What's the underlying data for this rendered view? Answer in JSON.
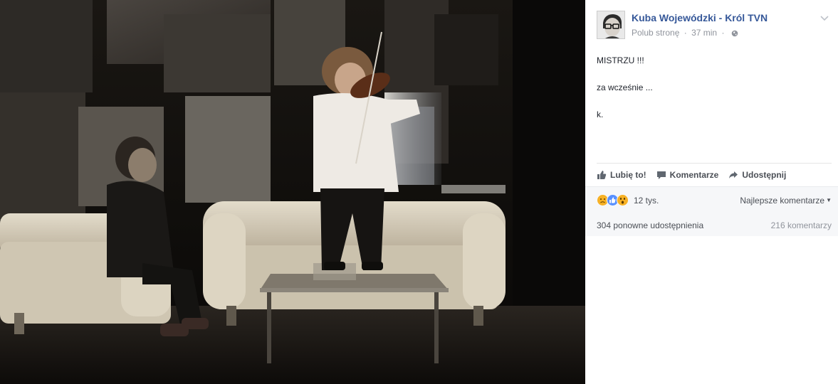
{
  "post": {
    "page_name": "Kuba Wojewódzki - Król TVN",
    "like_page_label": "Polub stronę",
    "separator": "·",
    "timestamp": "37 min",
    "audience_icon": "globe-icon",
    "text_lines": [
      "MISTRZU !!!",
      "za wcześnie ...",
      "k."
    ]
  },
  "actions": {
    "like_label": "Lubię to!",
    "comment_label": "Komentarze",
    "share_label": "Udostępnij"
  },
  "reactions": {
    "icons": [
      "sad-reaction-icon",
      "like-reaction-icon",
      "wow-reaction-icon"
    ],
    "count": "12 tys.",
    "sort_label": "Najlepsze komentarze",
    "shares": "304 ponowne udostępnienia",
    "comments": "216 komentarzy"
  },
  "colors": {
    "link": "#365899",
    "meta": "#90949c",
    "like_blue": "#5890ff",
    "reaction_yellow": "#f7b125"
  }
}
